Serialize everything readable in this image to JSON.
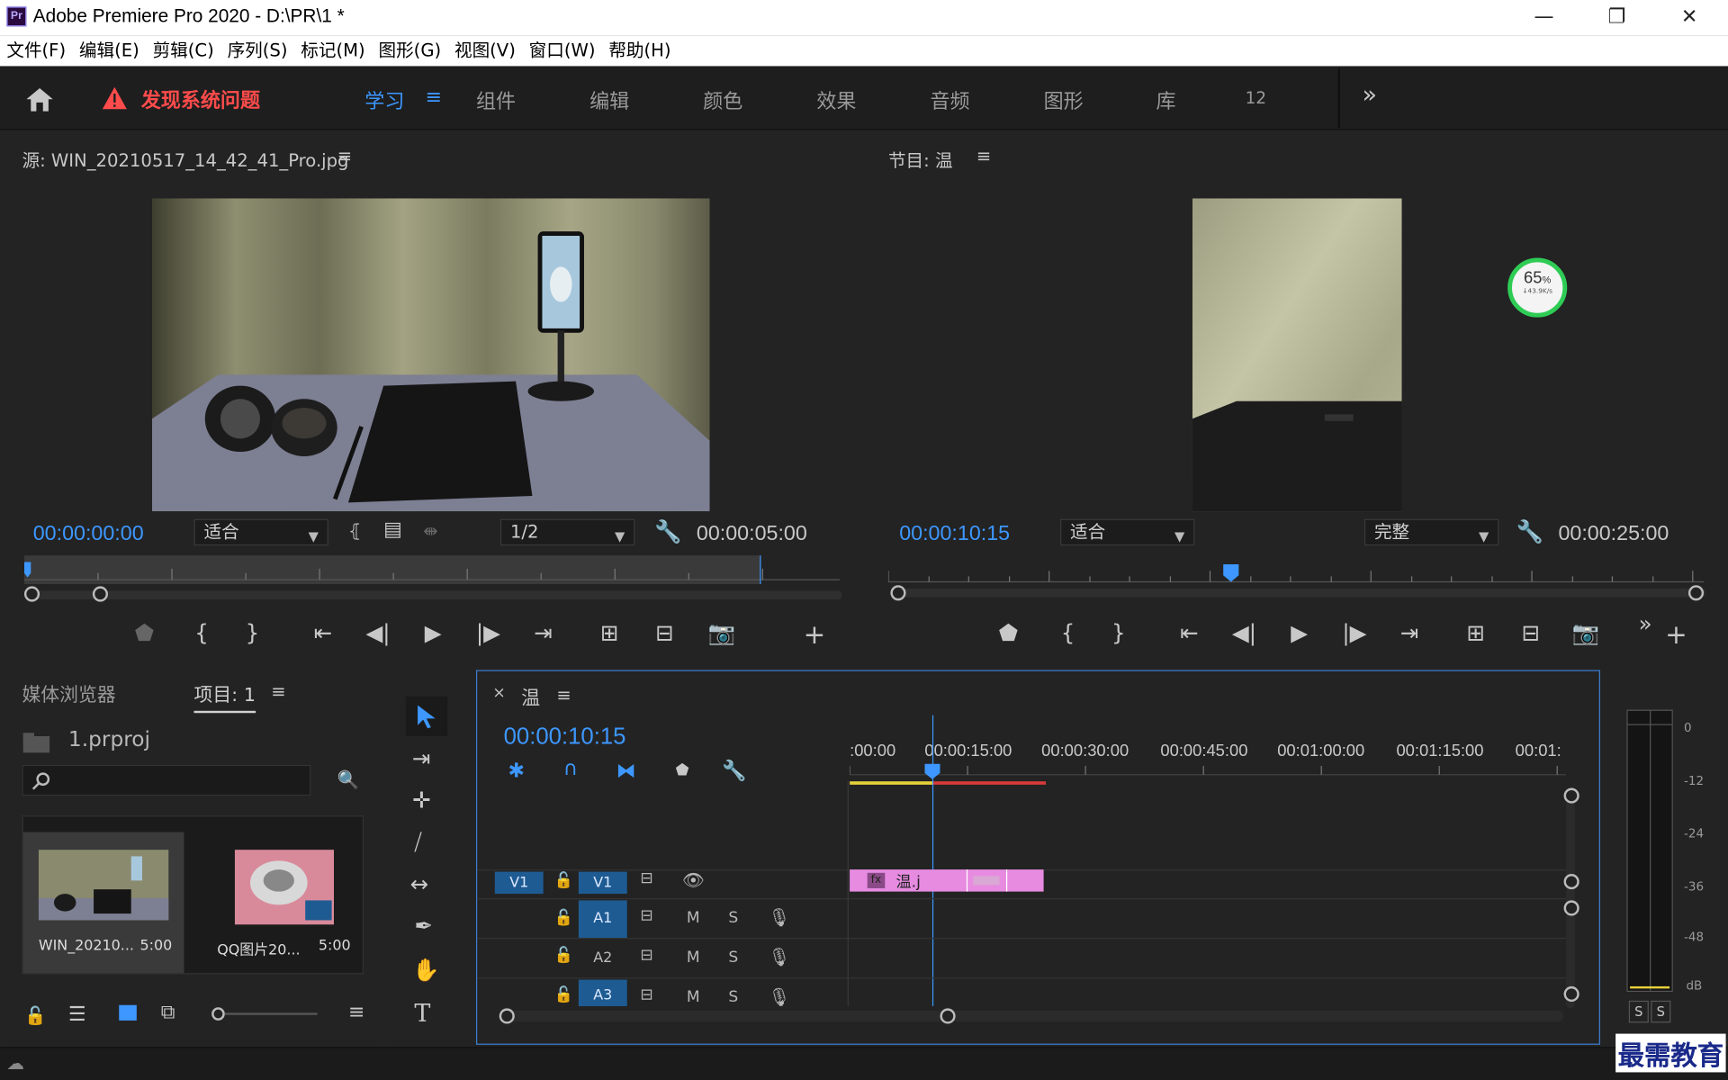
{
  "window": {
    "app_icon_label": "Pr",
    "title": "Adobe Premiere Pro 2020 - D:\\PR\\1 *",
    "minimize": "—",
    "restore": "❐",
    "close": "✕"
  },
  "menu": [
    "文件(F)",
    "编辑(E)",
    "剪辑(C)",
    "序列(S)",
    "标记(M)",
    "图形(G)",
    "视图(V)",
    "窗口(W)",
    "帮助(H)"
  ],
  "workspace": {
    "warning_text": "发现系统问题",
    "tabs": [
      {
        "label": "学习",
        "active": true
      },
      {
        "label": "组件",
        "active": false
      },
      {
        "label": "编辑",
        "active": false
      },
      {
        "label": "颜色",
        "active": false
      },
      {
        "label": "效果",
        "active": false
      },
      {
        "label": "音频",
        "active": false
      },
      {
        "label": "图形",
        "active": false
      },
      {
        "label": "库",
        "active": false
      },
      {
        "label": "12",
        "active": false
      }
    ],
    "more": "»",
    "accent_color": "#3d97ff",
    "warning_color": "#ff4b4b"
  },
  "source_monitor": {
    "title": "源: WIN_20210517_14_42_41_Pro.jpg",
    "timecode": "00:00:00:00",
    "fit": "适合",
    "resolution": "1/2",
    "duration": "00:00:05:00"
  },
  "program_monitor": {
    "title": "节目: 温",
    "timecode": "00:00:10:15",
    "fit": "适合",
    "quality": "完整",
    "duration": "00:00:25:00",
    "net_badge": {
      "percent": "65",
      "unit": "%",
      "speed": "↓43.9K/s"
    }
  },
  "project": {
    "tab_media_browser": "媒体浏览器",
    "tab_project": "项目: 1",
    "project_file": "1.prproj",
    "search_placeholder": "",
    "clips": [
      {
        "name": "WIN_20210...",
        "duration": "5:00"
      },
      {
        "name": "QQ图片20...",
        "duration": "5:00"
      }
    ]
  },
  "timeline": {
    "sequence_name": "温",
    "timecode": "00:00:10:15",
    "ruler_labels": [
      ":00:00",
      "00:00:15:00",
      "00:00:30:00",
      "00:00:45:00",
      "00:01:00:00",
      "00:01:15:00",
      "00:01:"
    ],
    "tracks": [
      {
        "source": "V1",
        "target": "V1",
        "type": "video"
      },
      {
        "source": "",
        "target": "A1",
        "type": "audio",
        "m": "M",
        "s": "S"
      },
      {
        "source": "",
        "target": "A2",
        "type": "audio",
        "m": "M",
        "s": "S"
      },
      {
        "source": "",
        "target": "A3",
        "type": "audio",
        "m": "M",
        "s": "S"
      }
    ],
    "clip_label": "温.j",
    "fx": "fx"
  },
  "meter": {
    "scale": [
      "0",
      "-12",
      "-24",
      "-36",
      "-48",
      "dB"
    ],
    "solo_left": "S",
    "solo_right": "S"
  },
  "watermark": "最需教育"
}
